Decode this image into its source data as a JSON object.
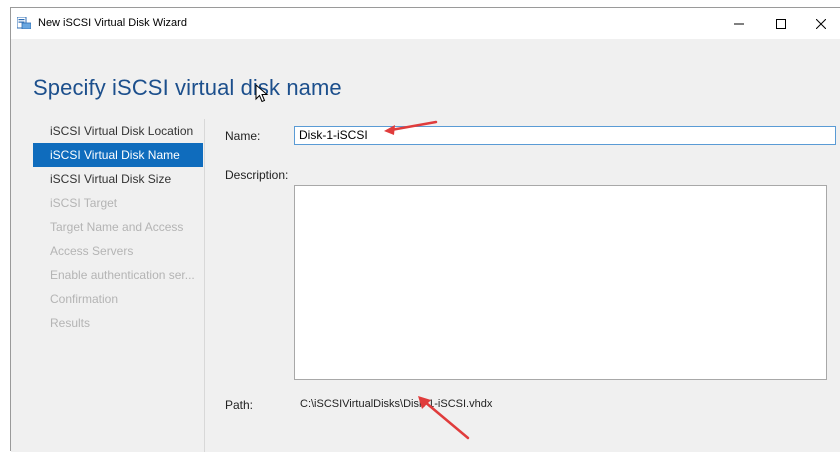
{
  "window": {
    "title": "New iSCSI Virtual Disk Wizard",
    "icon": "disk-wizard-icon",
    "controls": [
      "minimize-icon",
      "maximize-icon",
      "close-icon"
    ]
  },
  "page": {
    "title": "Specify iSCSI virtual disk name"
  },
  "nav": {
    "items": [
      {
        "label": "iSCSI Virtual Disk Location",
        "state": "normal"
      },
      {
        "label": "iSCSI Virtual Disk Name",
        "state": "selected"
      },
      {
        "label": "iSCSI Virtual Disk Size",
        "state": "normal"
      },
      {
        "label": "iSCSI Target",
        "state": "disabled"
      },
      {
        "label": "Target Name and Access",
        "state": "disabled"
      },
      {
        "label": "Access Servers",
        "state": "disabled"
      },
      {
        "label": "Enable authentication ser...",
        "state": "disabled"
      },
      {
        "label": "Confirmation",
        "state": "disabled"
      },
      {
        "label": "Results",
        "state": "disabled"
      }
    ]
  },
  "form": {
    "name_label": "Name:",
    "name_value": "Disk-1-iSCSI",
    "description_label": "Description:",
    "description_value": "",
    "path_label": "Path:",
    "path_value": "C:\\iSCSIVirtualDisks\\Disk-1-iSCSI.vhdx"
  },
  "colors": {
    "accent": "#0f6cbd",
    "title": "#1c4f8c",
    "annotation_arrow": "#e03c3c"
  }
}
